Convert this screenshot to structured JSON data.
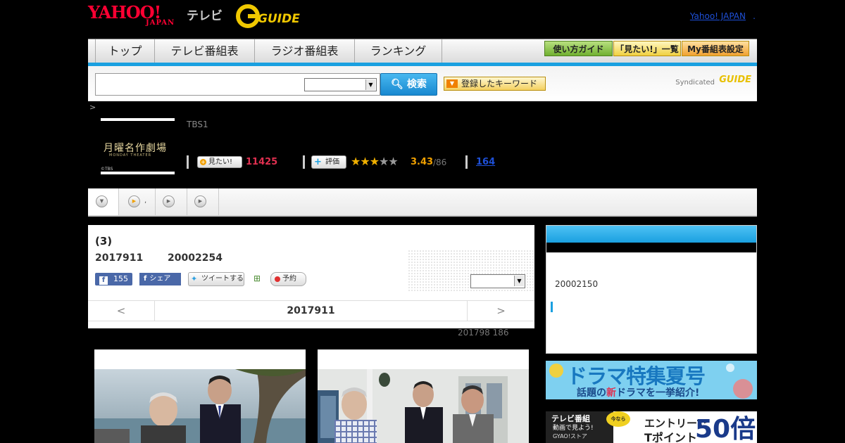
{
  "header": {
    "logo_yahoo": "YAHOO!",
    "logo_japan": "JAPAN",
    "logo_tv": "テレビ",
    "logo_gguide": "G GUIDE",
    "yahoo_japan_link": "Yahoo! JAPAN",
    "link_sep": "."
  },
  "nav": {
    "items": [
      "トップ",
      "テレビ番組表",
      "ラジオ番組表",
      "ランキング"
    ],
    "buttons": [
      "使い方ガイド",
      "「見たい!」一覧",
      "My番組表設定"
    ]
  },
  "search": {
    "input_value": "",
    "select_value": "",
    "button_label": "検索",
    "keyword_button": "登録したキーワード",
    "syndicated": "Syndicated",
    "syndicated_logo": "GUIDE"
  },
  "breadcrumb": ">",
  "program": {
    "thumb_title": "月曜名作劇場",
    "thumb_sub": "MONDAY THEATER",
    "thumb_tbs": "©TBS",
    "channel": "TBS1",
    "mitai_label": "見たい!",
    "mitai_count": "11425",
    "hyouka_label": "評価",
    "stars_filled": 3,
    "stars_total": 5,
    "rating": "3.43",
    "rating_count": "/86",
    "review_count": "164"
  },
  "tabs": {
    "tab2_label": ","
  },
  "episode": {
    "title": "(3)",
    "date": "2017911",
    "code": "20002254",
    "fb_like_count": "155",
    "fb_share": "シェア",
    "tweet": "ツイートする",
    "reserve": "予約",
    "select_value": "",
    "nav_prev": "<",
    "nav_current": "2017911",
    "nav_next": ">",
    "meta": "201798  186"
  },
  "sidebar": {
    "code": "20002150"
  },
  "banners": {
    "drama_title": "ドラマ特集夏号",
    "drama_sub_pre": "話題の",
    "drama_sub_new": "新",
    "drama_sub_post": "ドラマを一挙紹介!",
    "gyao_l1": "テレビ番組",
    "gyao_l2": "動画で見よう!",
    "gyao_l3": "GYAO!ストア",
    "gyao_badge": "今なら",
    "gyao_r1": "エントリーで",
    "gyao_r2": "Tポイント",
    "gyao_big": "50倍"
  },
  "colors": {
    "accent": "#1aa0e0",
    "yahoo_red": "#ff0033",
    "mitai_pink": "#e03050",
    "star": "#f0b000",
    "link": "#1e50d8"
  }
}
